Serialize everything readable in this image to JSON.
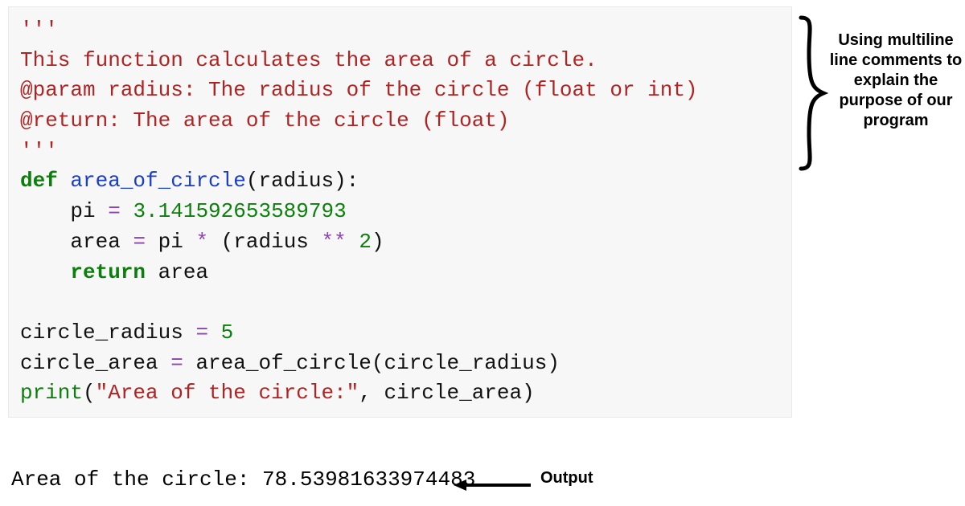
{
  "code_block": {
    "lines": [
      {
        "tokens": [
          {
            "text": "'''",
            "class": "c-str"
          }
        ]
      },
      {
        "tokens": [
          {
            "text": "This function calculates the area of a circle.",
            "class": "c-str"
          }
        ]
      },
      {
        "tokens": [
          {
            "text": "@param radius: The radius of the circle (float or int)",
            "class": "c-str"
          }
        ]
      },
      {
        "tokens": [
          {
            "text": "@return: The area of the circle (float)",
            "class": "c-str"
          }
        ]
      },
      {
        "tokens": [
          {
            "text": "'''",
            "class": "c-str"
          }
        ]
      },
      {
        "tokens": [
          {
            "text": "def",
            "class": "c-kw"
          },
          {
            "text": " ",
            "class": "c-default"
          },
          {
            "text": "area_of_circle",
            "class": "c-fn"
          },
          {
            "text": "(radius):",
            "class": "c-default"
          }
        ]
      },
      {
        "tokens": [
          {
            "text": "    pi ",
            "class": "c-default"
          },
          {
            "text": "=",
            "class": "c-op"
          },
          {
            "text": " ",
            "class": "c-default"
          },
          {
            "text": "3.141592653589793",
            "class": "c-num"
          }
        ]
      },
      {
        "tokens": [
          {
            "text": "    area ",
            "class": "c-default"
          },
          {
            "text": "=",
            "class": "c-op"
          },
          {
            "text": " pi ",
            "class": "c-default"
          },
          {
            "text": "*",
            "class": "c-op"
          },
          {
            "text": " (radius ",
            "class": "c-default"
          },
          {
            "text": "**",
            "class": "c-op"
          },
          {
            "text": " ",
            "class": "c-default"
          },
          {
            "text": "2",
            "class": "c-num"
          },
          {
            "text": ")",
            "class": "c-default"
          }
        ]
      },
      {
        "tokens": [
          {
            "text": "    ",
            "class": "c-default"
          },
          {
            "text": "return",
            "class": "c-kw"
          },
          {
            "text": " area",
            "class": "c-default"
          }
        ]
      },
      {
        "tokens": [
          {
            "text": "",
            "class": "c-default"
          }
        ]
      },
      {
        "tokens": [
          {
            "text": "circle_radius ",
            "class": "c-default"
          },
          {
            "text": "=",
            "class": "c-op"
          },
          {
            "text": " ",
            "class": "c-default"
          },
          {
            "text": "5",
            "class": "c-num"
          }
        ]
      },
      {
        "tokens": [
          {
            "text": "circle_area ",
            "class": "c-default"
          },
          {
            "text": "=",
            "class": "c-op"
          },
          {
            "text": " area_of_circle(circle_radius)",
            "class": "c-default"
          }
        ]
      },
      {
        "tokens": [
          {
            "text": "print",
            "class": "c-print"
          },
          {
            "text": "(",
            "class": "c-default"
          },
          {
            "text": "\"Area of the circle:\"",
            "class": "c-litstr"
          },
          {
            "text": ", circle_area)",
            "class": "c-default"
          }
        ]
      }
    ]
  },
  "annotation_right": "Using multiline line comments to explain the purpose of our program",
  "output_text": "Area of the circle: 78.53981633974483",
  "output_label": "Output"
}
